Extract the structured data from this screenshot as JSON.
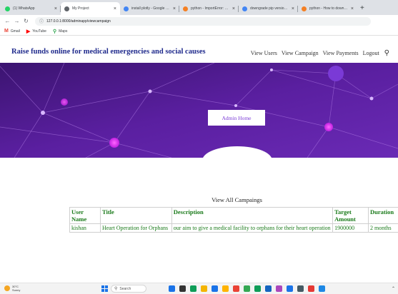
{
  "browser": {
    "tabs": [
      {
        "label": "(1) WhatsApp",
        "favicon_color": "#25d366",
        "active": false
      },
      {
        "label": "My Project",
        "favicon_color": "#5f6368",
        "active": true
      },
      {
        "label": "install plotly - Google Search",
        "favicon_color": "#4285f4",
        "active": false
      },
      {
        "label": "python - ImportError: cannot",
        "favicon_color": "#f48024",
        "active": false
      },
      {
        "label": "downgrade pip version - G",
        "favicon_color": "#4285f4",
        "active": false
      },
      {
        "label": "python - How to downgrade",
        "favicon_color": "#f48024",
        "active": false
      }
    ],
    "new_tab_label": "+",
    "address": "127.0.0.1:8000/adminapp/viewcampaign",
    "bookmarks": [
      {
        "icon": "M",
        "label": "Gmail",
        "color": "#ea4335"
      },
      {
        "icon": "▶",
        "label": "YouTube",
        "color": "#ff0000"
      },
      {
        "icon": "⚲",
        "label": "Maps",
        "color": "#34a853"
      }
    ]
  },
  "site": {
    "brand": "Raise funds online for medical emergencies and social causes",
    "menu": [
      "View Users",
      "View Campaign",
      "View Payments",
      "Logout"
    ],
    "hero_button": "Admin Home",
    "table_title": "View All Campaings",
    "table": {
      "headers": [
        "User Name",
        "Title",
        "Description",
        "Target Amount",
        "Duration"
      ],
      "rows": [
        [
          "kishan",
          "Heart Operation for Orphans",
          "our aim to give a medical facility to orphans for their heart operation",
          "1900000",
          "2 months"
        ]
      ]
    }
  },
  "taskbar": {
    "weather_temp": "30°C",
    "weather_desc": "Sunny",
    "search_label": "Search",
    "app_icon_colors": [
      "#1a73e8",
      "#333333",
      "#0f9d58",
      "#f4b400",
      "#1a73e8",
      "#ffb300",
      "#ea4335",
      "#34a853",
      "#0f9d58",
      "#1565c0",
      "#ab47bc",
      "#1a73e8",
      "#455a64",
      "#e53935",
      "#1e88e5"
    ]
  },
  "colors": {
    "brand": "#1f2a8c",
    "hero_bg": "#4a1a8a",
    "table_text": "#1a7a1a"
  }
}
